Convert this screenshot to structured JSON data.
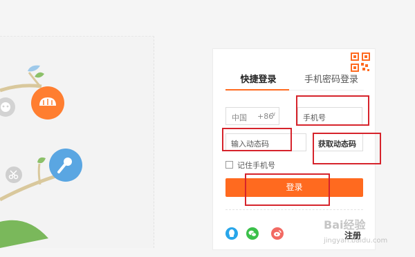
{
  "login": {
    "tabs": {
      "quick_login": "快捷登录",
      "password_login": "手机密码登录"
    },
    "country": {
      "name": "中国",
      "code": "+86"
    },
    "phone_placeholder": "手机号",
    "sms_placeholder": "输入动态码",
    "get_code_label": "获取动态码",
    "remember_label": "记住手机号",
    "submit_label": "登录",
    "register_label": "注册"
  },
  "icons": {
    "qr": "qr-code-icon",
    "social": [
      "qq-icon",
      "wechat-icon",
      "weibo-icon"
    ],
    "illustration": [
      "bread-icon",
      "microphone-icon",
      "scissors-icon",
      "mask-icon"
    ]
  },
  "colors": {
    "accent": "#ff6a1f",
    "annotation": "#d6232b"
  },
  "watermark": {
    "brand": "Bai",
    "suffix": "经验",
    "domain": "jingyan.baidu.com"
  }
}
